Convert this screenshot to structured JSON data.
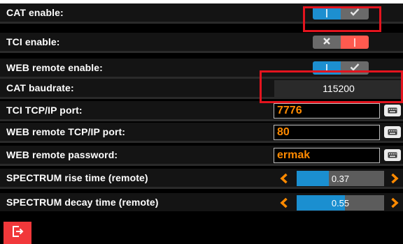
{
  "settings": {
    "cat_enable": {
      "label": "CAT enable:",
      "state": "on"
    },
    "tci_enable": {
      "label": "TCI enable:",
      "state": "off"
    },
    "web_remote_enable": {
      "label": "WEB remote enable:",
      "state": "on"
    },
    "cat_baudrate": {
      "label": "CAT baudrate:",
      "value": "115200"
    },
    "tci_port": {
      "label": "TCI TCP/IP port:",
      "value": "7776"
    },
    "web_port": {
      "label": "WEB remote TCP/IP port:",
      "value": "80"
    },
    "web_password": {
      "label": "WEB remote password:",
      "value": "ermak"
    },
    "spectrum_rise": {
      "label": "SPECTRUM rise time (remote)",
      "value": "0.37",
      "fill": 0.37
    },
    "spectrum_decay": {
      "label": "SPECTRUM decay time (remote)",
      "value": "0.55",
      "fill": 0.55
    }
  },
  "icons": {
    "toggle_on": "check-icon",
    "toggle_off": "x-icon",
    "keyboard": "keyboard-icon",
    "arrow_left": "chevron-left-icon",
    "arrow_right": "chevron-right-icon",
    "exit": "exit-icon"
  },
  "colors": {
    "accent_blue": "#1d8fd0",
    "toggle_off_red": "#ff5a4f",
    "input_text_orange": "#ff8a00",
    "exit_button_red": "#f1383a",
    "highlight_red": "#e3141e"
  }
}
